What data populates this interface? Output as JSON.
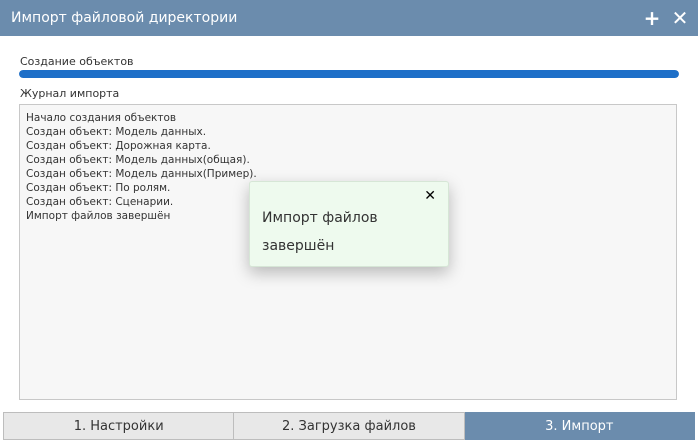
{
  "window": {
    "title": "Импорт файловой директории",
    "add_icon": "plus-icon",
    "close_icon": "close-icon"
  },
  "progress": {
    "label": "Создание объектов",
    "fraction": 1.0,
    "color": "#1e6fc8"
  },
  "log": {
    "label": "Журнал импорта",
    "lines": [
      "Начало создания объектов",
      "Создан объект: Модель данных.",
      "Создан объект: Дорожная карта.",
      "Создан объект: Модель данных(общая).",
      "Создан объект: Модель данных(Пример).",
      "Создан объект: По ролям.",
      "Создан объект: Сценарии.",
      "Импорт файлов завершён"
    ]
  },
  "toast": {
    "message": "Импорт файлов завершён",
    "close_icon": "close-icon",
    "background": "#eefaee"
  },
  "tabs": [
    {
      "label": "1. Настройки",
      "active": false
    },
    {
      "label": "2. Загрузка файлов",
      "active": false
    },
    {
      "label": "3. Импорт",
      "active": true
    }
  ],
  "colors": {
    "titlebar": "#6b8cad",
    "active_tab": "#6b8cad"
  }
}
